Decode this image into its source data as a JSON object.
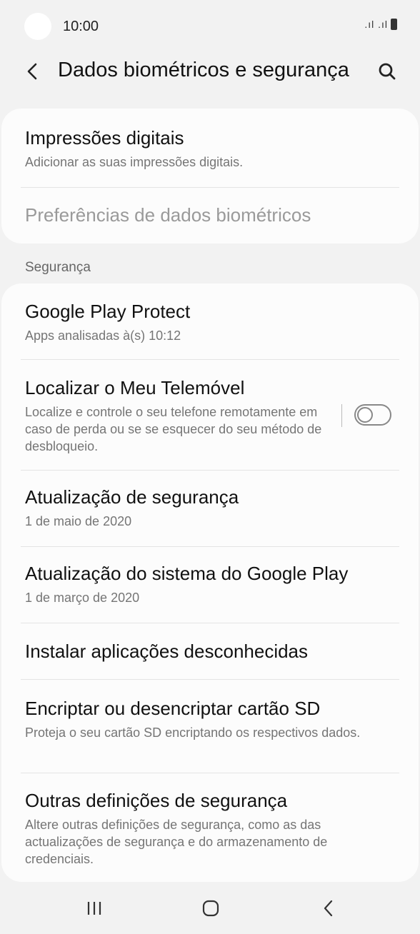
{
  "status_bar": {
    "time": "10:00",
    "signal_text": ".ıl .ıl"
  },
  "header": {
    "title": "Dados biométricos e segurança"
  },
  "biometrics": {
    "fingerprints": {
      "title": "Impressões digitais",
      "subtitle": "Adicionar as suas impressões digitais."
    },
    "preferences": {
      "title": "Preferências de dados biométricos"
    }
  },
  "security": {
    "header": "Segurança",
    "items": [
      {
        "title": "Google Play Protect",
        "subtitle": "Apps analisadas à(s) 10:12"
      },
      {
        "title": "Localizar o Meu Telemóvel",
        "subtitle": "Localize e controle o seu telefone remotamente em caso de perda ou se se esquecer do seu método de desbloqueio."
      },
      {
        "title": "Atualização de segurança",
        "subtitle": "1 de maio de 2020"
      },
      {
        "title": "Atualização do sistema do Google Play",
        "subtitle": "1 de março de 2020"
      },
      {
        "title": "Instalar aplicações desconhecidas"
      },
      {
        "title": "Encriptar ou desencriptar cartão SD",
        "subtitle": "Proteja o seu cartão SD encriptando os respectivos dados."
      },
      {
        "title": "Outras definições de segurança",
        "subtitle": "Altere outras definições de segurança, como as das actualizações de segurança e do armazenamento de credenciais."
      }
    ],
    "find_my_mobile_enabled": false
  },
  "icons": {
    "back": "chevron-left-icon",
    "search": "search-icon",
    "recents": "recents-icon",
    "home": "home-icon",
    "nav_back": "back-icon"
  },
  "colors": {
    "background": "#f2f2f2",
    "card": "#fcfcfc",
    "disabled_text": "#9a9a9a"
  }
}
